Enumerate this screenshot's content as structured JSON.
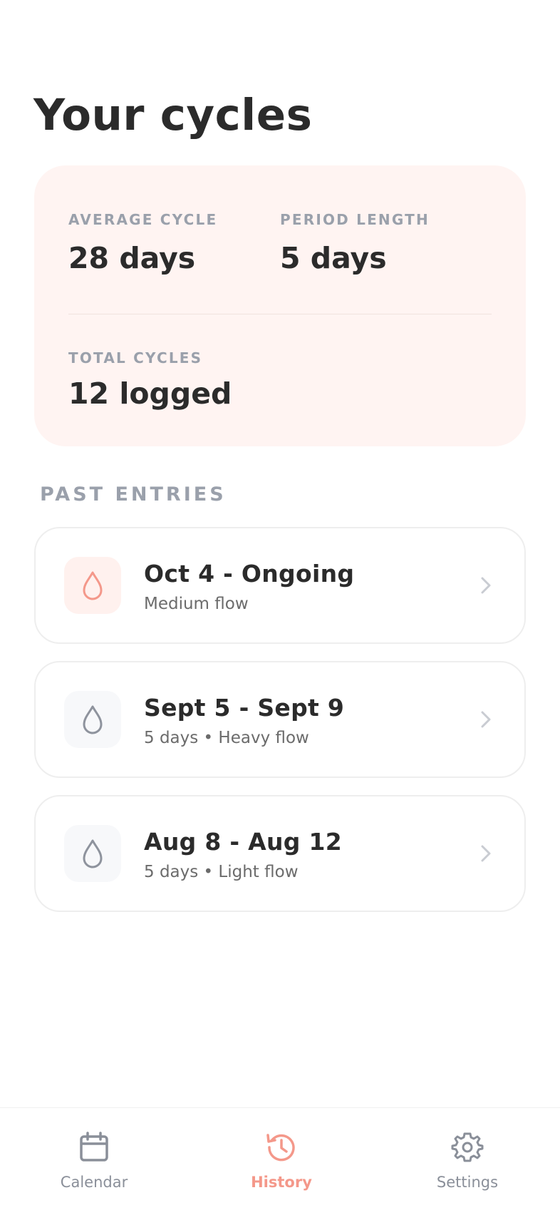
{
  "header": {
    "title": "Your cycles"
  },
  "stats": {
    "average_cycle": {
      "label": "AVERAGE CYCLE",
      "value": "28 days"
    },
    "period_length": {
      "label": "PERIOD LENGTH",
      "value": "5 days"
    },
    "total_cycles": {
      "label": "TOTAL CYCLES",
      "value": "12 logged"
    }
  },
  "past_entries": {
    "title": "PAST ENTRIES",
    "items": [
      {
        "title": "Oct 4 - Ongoing",
        "subtitle": "Medium flow",
        "icon": "droplet-icon",
        "active": true
      },
      {
        "title": "Sept 5 - Sept 9",
        "subtitle": "5 days • Heavy flow",
        "icon": "droplet-icon",
        "active": false
      },
      {
        "title": "Aug 8 - Aug 12",
        "subtitle": "5 days • Light flow",
        "icon": "droplet-icon",
        "active": false
      }
    ]
  },
  "nav": {
    "items": [
      {
        "label": "Calendar",
        "icon": "calendar-icon",
        "active": false
      },
      {
        "label": "History",
        "icon": "history-icon",
        "active": true
      },
      {
        "label": "Settings",
        "icon": "gear-icon",
        "active": false
      }
    ]
  },
  "colors": {
    "accent": "#f4988a",
    "card_background": "#fff4f2",
    "muted": "#9aa0ab",
    "text": "#2b2b2b"
  }
}
